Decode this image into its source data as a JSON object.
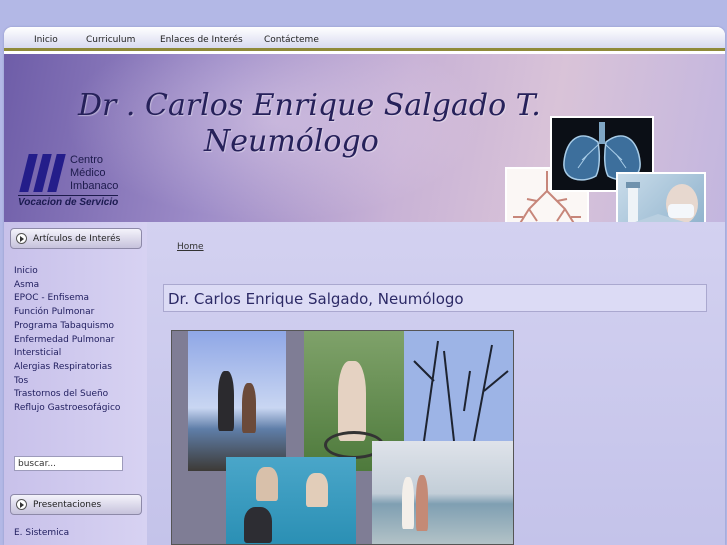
{
  "nav": {
    "items": [
      "Inicio",
      "Curriculum",
      "Enlaces de Interés",
      "Contácteme"
    ]
  },
  "banner": {
    "title_line1": "Dr . Carlos  Enrique Salgado T.",
    "title_line2": "Neumólogo",
    "logo_line1": "Centro",
    "logo_line2": "Médico",
    "logo_line3": "Imbanaco",
    "logo_tagline": "Vocacion de Servicio"
  },
  "sidebar": {
    "box1_title": "Artículos de Interés",
    "links": [
      "Inicio",
      "Asma",
      "EPOC - Enfisema",
      "Función Pulmonar",
      "Programa Tabaquismo",
      "Enfermedad Pulmonar Intersticial",
      "Alergias Respiratorias",
      "Tos",
      "Trastornos del Sueño",
      "Reflujo Gastroesofágico"
    ],
    "search_placeholder": "buscar...",
    "box2_title": "Presentaciones",
    "box2_links": [
      "E. Sistemica"
    ]
  },
  "content": {
    "breadcrumb": "Home",
    "heading": "Dr. Carlos Enrique Salgado, Neumólogo"
  },
  "colors": {
    "page_bg": "#b3b8e6",
    "nav_underline": "#8f8a3a",
    "title_text": "#26215a",
    "link_text": "#1f1d5e"
  }
}
